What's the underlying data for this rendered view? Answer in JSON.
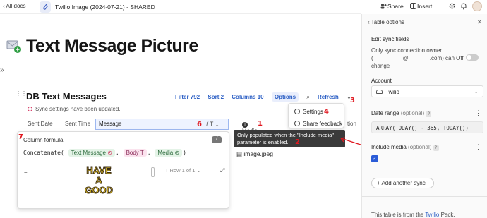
{
  "topbar": {
    "all_docs": "‹ All docs",
    "doc_title": "Twilio Image (2024-07-21) - SHARED",
    "share": "Share",
    "insert": "Insert"
  },
  "page": {
    "title": "Text Message Picture"
  },
  "table": {
    "title": "DB Text Messages",
    "toolbar": {
      "filter": "Filter 792",
      "sort": "Sort 2",
      "columns": "Columns 10",
      "options": "Options",
      "refresh": "Refresh"
    },
    "sync_message": "Sync settings have been updated.",
    "columns": [
      "Sent Date",
      "Sent Time",
      "Message",
      "Media"
    ],
    "media_file": "image.jpeg"
  },
  "formula_panel": {
    "title": "Column formula",
    "badge": "f",
    "function": "Concatenate(",
    "chip1": "Text Message",
    "chip2": "Body",
    "chip3": "Media",
    "close_paren": ")",
    "eq": "=",
    "image_words": [
      "HAVE",
      "A",
      "GOOD"
    ],
    "row_label": "Row 1 of 1"
  },
  "menu": {
    "settings": "Settings",
    "share_feedback": "Share feedback",
    "sync_option_tail": "tion"
  },
  "tooltip": {
    "text": "Only populated when the \"Include media\" parameter is enabled."
  },
  "annotations": [
    "1",
    "2",
    "3",
    "4",
    "5",
    "6",
    "7"
  ],
  "right_panel": {
    "back": "‹ Table options",
    "edit_heading": "Edit sync fields",
    "owner_line1": "Only sync connection owner",
    "owner_line2a": "(",
    "owner_line2b": "@",
    "owner_line2c": ".com) can",
    "owner_off": "Off",
    "owner_line3": "change",
    "account_label": "Account",
    "account_value": "Twilio",
    "date_label": "Date range",
    "date_optional": "(optional)",
    "date_value": "ARRAY(TODAY() - 365, TODAY())",
    "media_label": "Include media",
    "media_optional": "(optional)",
    "add_sync": "+ Add another sync",
    "footer_prefix": "This table is from the ",
    "footer_link": "Twilio",
    "footer_suffix": " Pack."
  },
  "colors": {
    "accent": "#2d60c5",
    "annotation": "#e0171f",
    "checkbox": "#2a5bd7"
  }
}
